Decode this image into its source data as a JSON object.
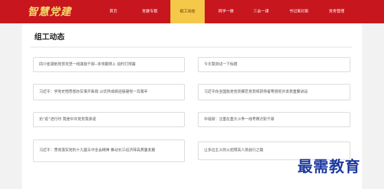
{
  "header": {
    "logo_text": "智慧党建",
    "nav": [
      {
        "label": "首页",
        "active": false
      },
      {
        "label": "党建专题",
        "active": false
      },
      {
        "label": "组工动态",
        "active": true
      },
      {
        "label": "两学一做",
        "active": false
      },
      {
        "label": "三会一课",
        "active": false
      },
      {
        "label": "书记面对面",
        "active": false
      },
      {
        "label": "党务管理",
        "active": false
      }
    ],
    "brand_color": "#c8161e",
    "active_color": "#f5c84a"
  },
  "main": {
    "title": "组工动态",
    "news": [
      "四川省港航党员攻坚一线激励干部--本领磨得上 战时打得赢",
      "今天我测试一下标题",
      "习近平：学党史悟思想办实事开新局 以优异成绩迎接建党一百周年",
      "习近平向全国航党党员模范党员将获得者等颁奖并发表重要讲话",
      "抗“疫”进行时 我是中共党员我承诺",
      "中组部：注重在重大斗争一线考察识别干部",
      "习近平：贯彻落实党的十九届五中全会精神 推动长江经济带高质量发展",
      "让多边主义的火炬照亮人类前行之路"
    ]
  },
  "watermark": {
    "text": "最需教育",
    "color": "#1e3a9f"
  }
}
